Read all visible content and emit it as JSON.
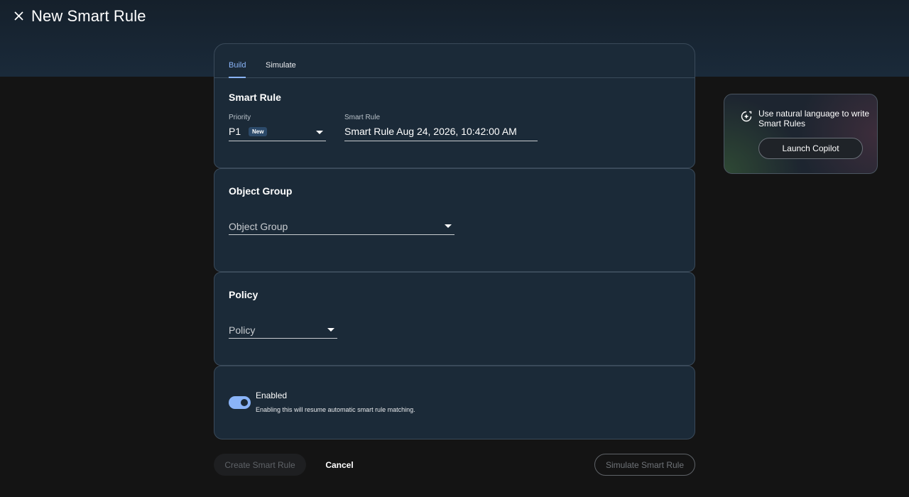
{
  "header": {
    "title": "New Smart Rule"
  },
  "tabs": [
    {
      "label": "Build",
      "active": true
    },
    {
      "label": "Simulate",
      "active": false
    }
  ],
  "smart_rule_section": {
    "title": "Smart Rule",
    "priority": {
      "label": "Priority",
      "value": "P1",
      "badge": "New"
    },
    "name": {
      "label": "Smart Rule",
      "value": "Smart Rule Aug 24, 2026, 10:42:00 AM"
    }
  },
  "object_group_section": {
    "title": "Object Group",
    "placeholder": "Object Group"
  },
  "policy_section": {
    "title": "Policy",
    "placeholder": "Policy"
  },
  "enabled_section": {
    "label": "Enabled",
    "description": "Enabling this will resume automatic smart rule matching.",
    "on": true
  },
  "actions": {
    "create": "Create Smart Rule",
    "cancel": "Cancel",
    "simulate": "Simulate Smart Rule"
  },
  "copilot": {
    "text": "Use natural language to write Smart Rules",
    "button": "Launch Copilot"
  },
  "colors": {
    "accent": "#8ab4f8",
    "card_bg": "#1b2a38",
    "page_bg": "#141414"
  },
  "icons": {
    "close": "close-icon",
    "copilot": "copilot-sparkle-icon",
    "dropdown": "caret-down-icon"
  }
}
